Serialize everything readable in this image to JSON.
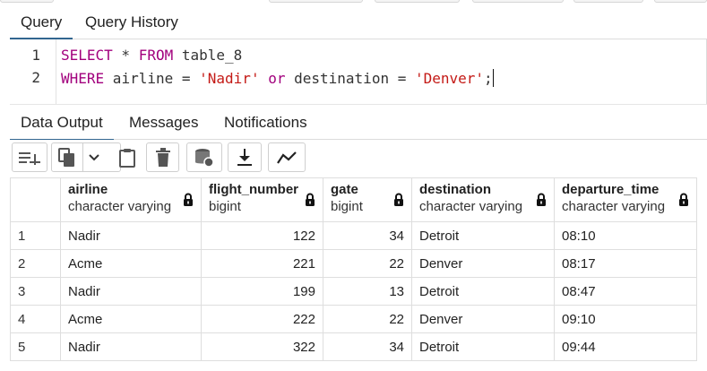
{
  "query_tabs": [
    {
      "label": "Query",
      "active": true
    },
    {
      "label": "Query History",
      "active": false
    }
  ],
  "editor": {
    "line_numbers": [
      "1",
      "2"
    ],
    "line1": {
      "kw1": "SELECT",
      "rest1": " * ",
      "kw2": "FROM",
      "rest2": " table_8"
    },
    "line2": {
      "kw1": "WHERE",
      "rest1": " airline = ",
      "str1": "'Nadir'",
      "sp1": " ",
      "kw2": "or",
      "rest2": " destination = ",
      "str2": "'Denver'",
      "end": ";"
    }
  },
  "output_tabs": [
    {
      "label": "Data Output",
      "active": true
    },
    {
      "label": "Messages",
      "active": false
    },
    {
      "label": "Notifications",
      "active": false
    }
  ],
  "toolbar_icons": [
    "add-row-icon",
    "copy-icon",
    "chevron-down-icon",
    "paste-icon",
    "delete-icon",
    "save-data-icon",
    "download-icon",
    "graph-icon"
  ],
  "columns": [
    {
      "name": "airline",
      "type": "character varying"
    },
    {
      "name": "flight_number",
      "type": "bigint"
    },
    {
      "name": "gate",
      "type": "bigint"
    },
    {
      "name": "destination",
      "type": "character varying"
    },
    {
      "name": "departure_time",
      "type": "character varying"
    }
  ],
  "rows": [
    {
      "num": "1",
      "airline": "Nadir",
      "flight_number": "122",
      "gate": "34",
      "destination": "Detroit",
      "departure_time": "08:10"
    },
    {
      "num": "2",
      "airline": "Acme",
      "flight_number": "221",
      "gate": "22",
      "destination": "Denver",
      "departure_time": "08:17"
    },
    {
      "num": "3",
      "airline": "Nadir",
      "flight_number": "199",
      "gate": "13",
      "destination": "Detroit",
      "departure_time": "08:47"
    },
    {
      "num": "4",
      "airline": "Acme",
      "flight_number": "222",
      "gate": "22",
      "destination": "Denver",
      "departure_time": "09:10"
    },
    {
      "num": "5",
      "airline": "Nadir",
      "flight_number": "322",
      "gate": "34",
      "destination": "Detroit",
      "departure_time": "09:44"
    }
  ],
  "colors": {
    "accent": "#326690",
    "keyword": "#a2007d",
    "string": "#c41a16"
  }
}
